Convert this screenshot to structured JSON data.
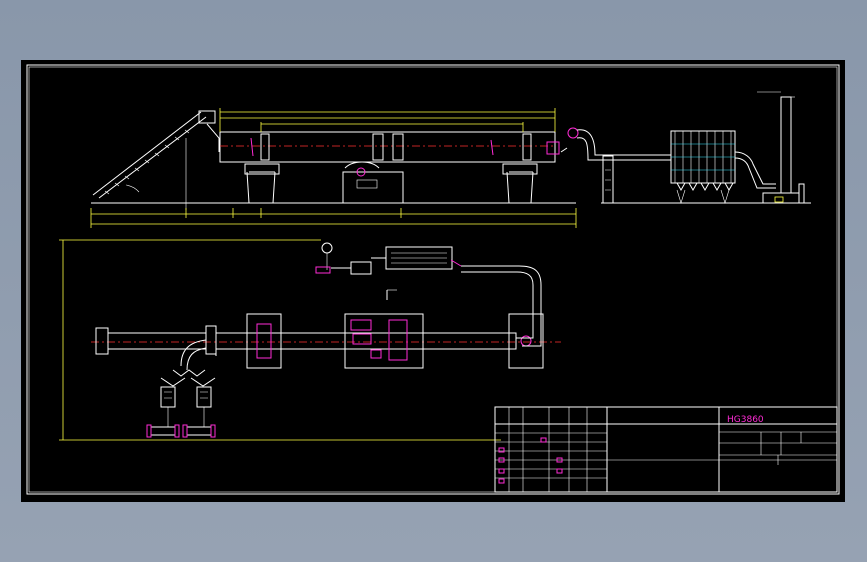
{
  "title_block": {
    "model": "HG3860",
    "cells_row1": [
      "",
      "",
      "",
      "",
      "",
      "",
      ""
    ],
    "cells_row2": [
      "",
      "",
      "",
      "",
      "",
      "",
      ""
    ]
  },
  "dimensions": {
    "overall_length": "",
    "plan_width": ""
  },
  "colors": {
    "frame": "#ffffff",
    "equipment": "#ffffff",
    "highlight": "#ff2bd6",
    "centerline": "#ff3030",
    "dimension": "#ffff40",
    "hatch": "#39e6ff"
  }
}
